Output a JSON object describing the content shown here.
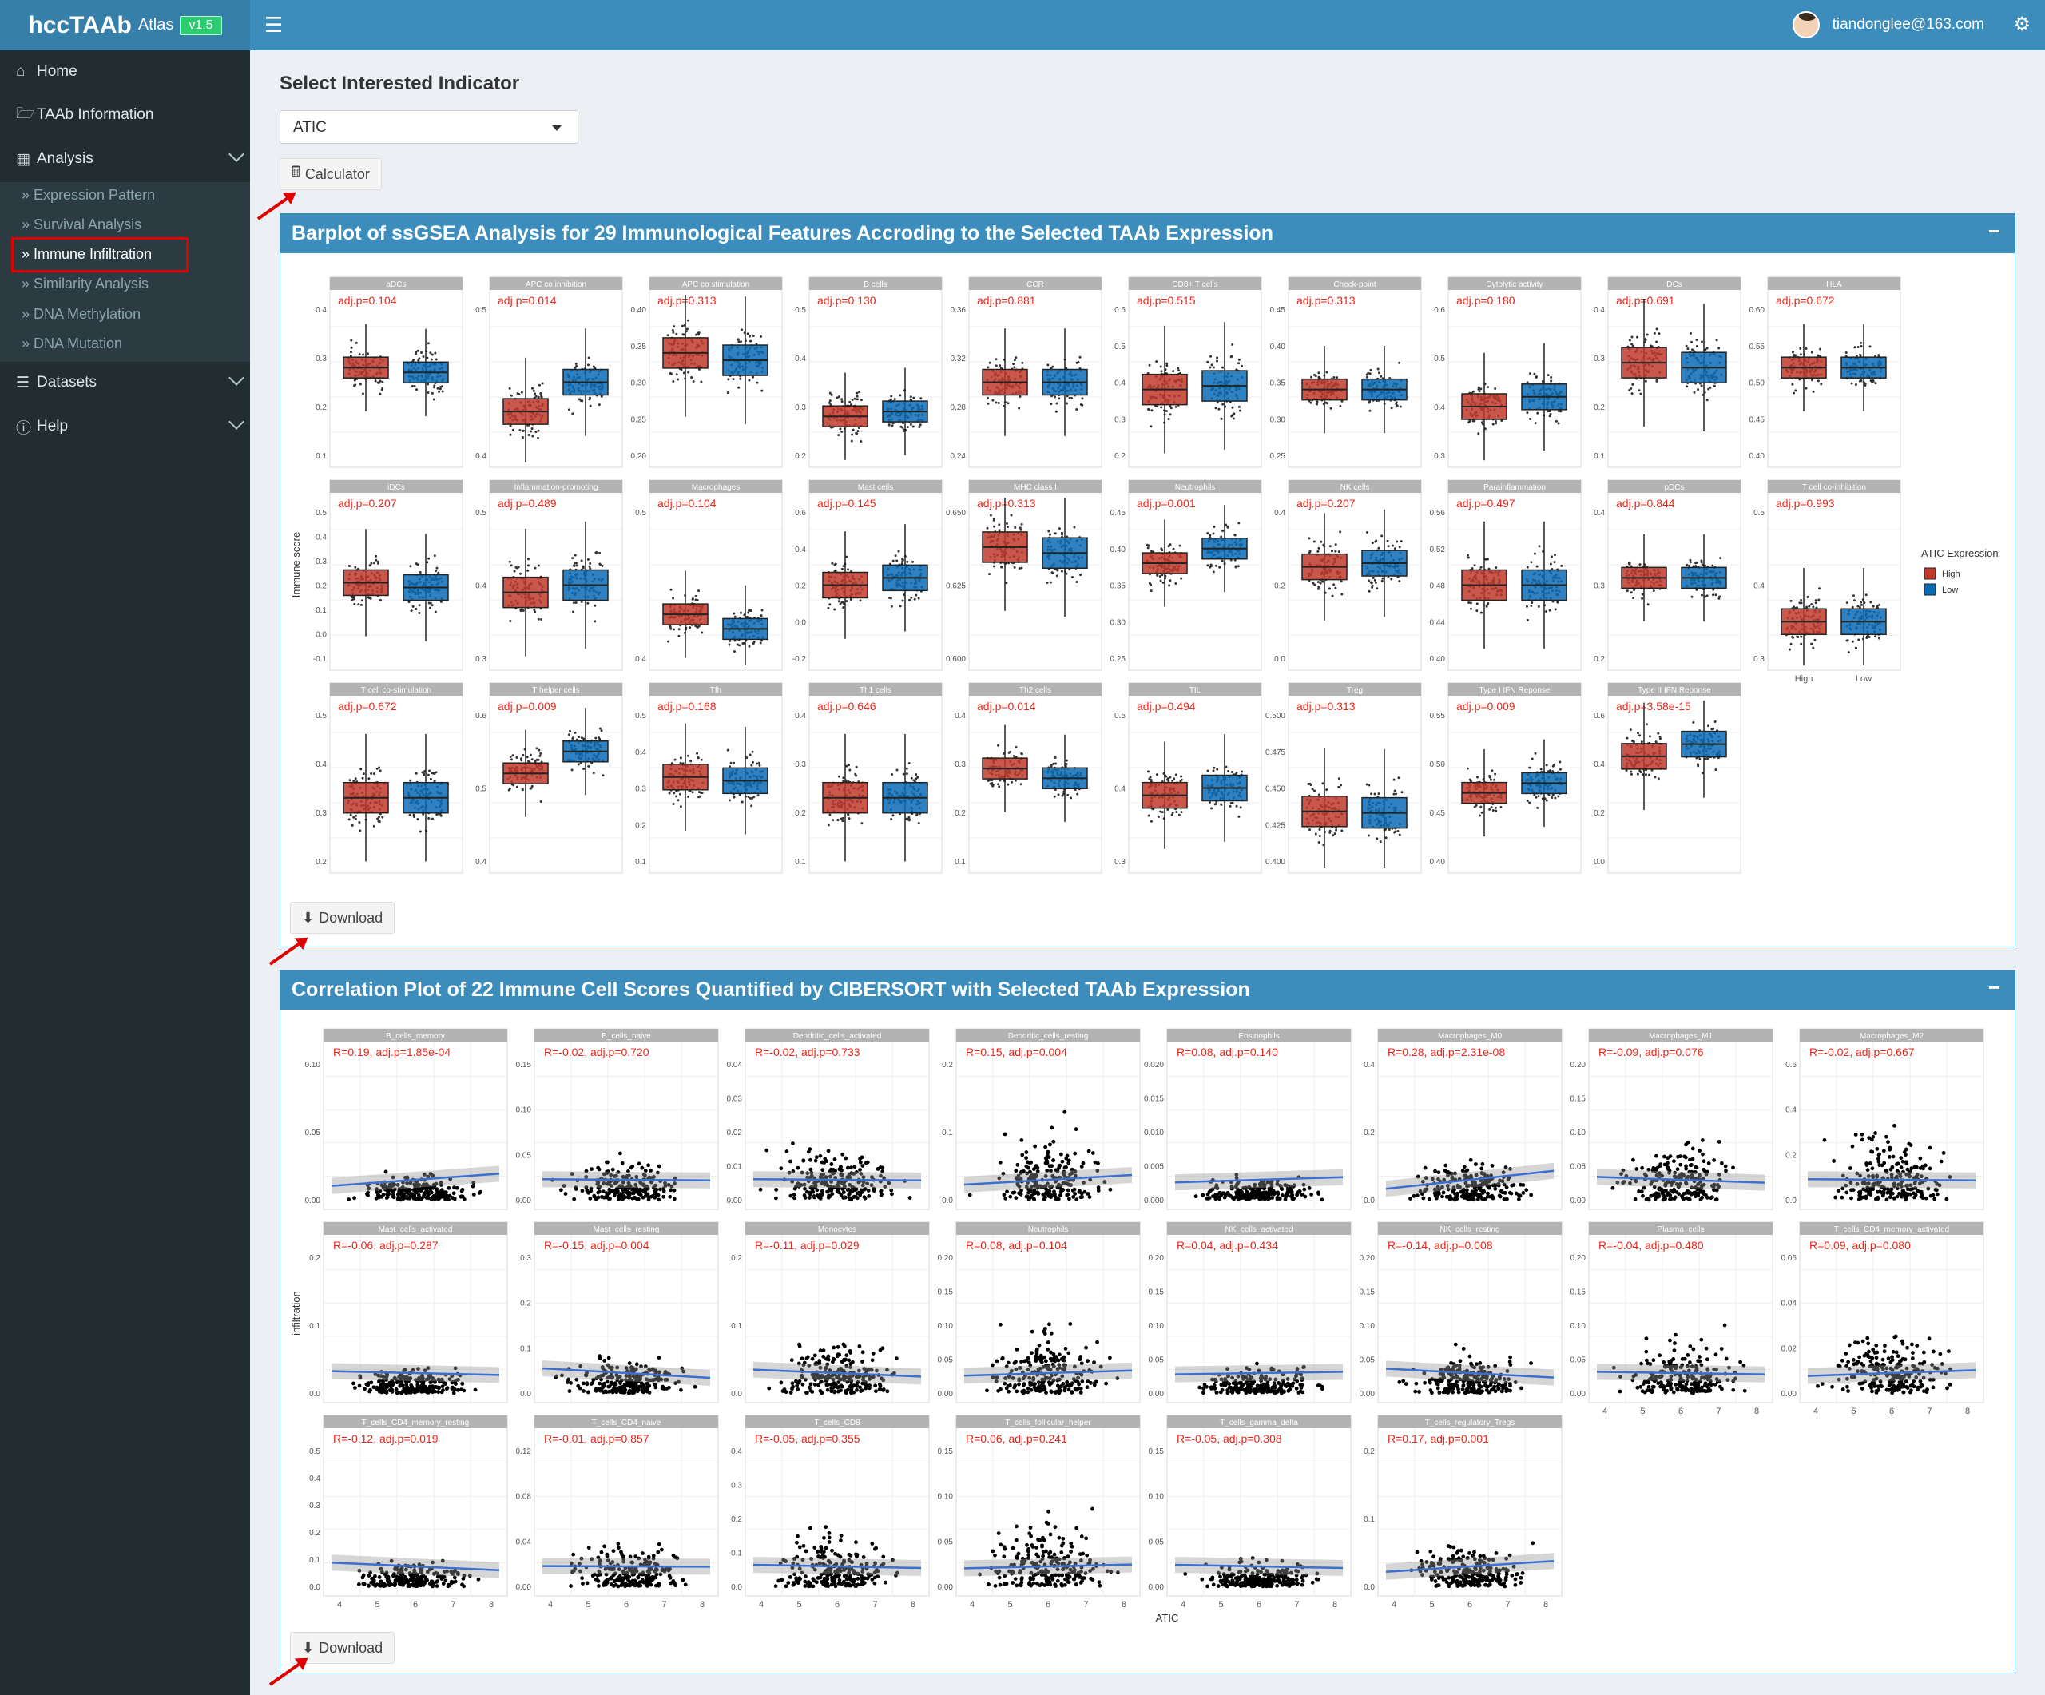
{
  "app": {
    "logo_main": "hccTAAb",
    "logo_sub": "Atlas",
    "version": "v1.5",
    "user_email": "tiandonglee@163.com"
  },
  "sidebar": {
    "items": [
      {
        "label": "Home",
        "icon": "home-icon"
      },
      {
        "label": "TAAb Information",
        "icon": "folder-open-icon"
      },
      {
        "label": "Analysis",
        "icon": "bar-chart-icon"
      },
      {
        "label": "Datasets",
        "icon": "database-icon"
      },
      {
        "label": "Help",
        "icon": "info-icon"
      }
    ],
    "sub_items": [
      "Expression Pattern",
      "Survival Analysis",
      "Immune Infiltration",
      "Similarity Analysis",
      "DNA Methylation",
      "DNA Mutation"
    ],
    "active_sub": "Immune Infiltration"
  },
  "main": {
    "indicator_title": "Select Interested Indicator",
    "indicator_value": "ATIC",
    "calculator_label": "Calculator",
    "box1_title": "Barplot of ssGSEA Analysis for 29 Immunological Features Accroding to the Selected TAAb Expression",
    "box2_title": "Correlation Plot of 22 Immune Cell Scores Quantified by CIBERSORT with Selected TAAb Expression",
    "download_label": "Download",
    "collapse_symbol": "−"
  },
  "colors": {
    "high": "#c0392b",
    "low": "#0b6bb5",
    "panel_strip": "#b3b3b3",
    "panel_text": "#e8271b",
    "fit_line": "#3b6fd1"
  },
  "chart_data": [
    {
      "type": "boxplot",
      "ylabel": "Immune score",
      "legend": {
        "title": "ATIC Expression",
        "entries": [
          "High",
          "Low"
        ],
        "position": "right"
      },
      "x_categories": [
        "High",
        "Low"
      ],
      "panels": [
        {
          "name": "aDCs",
          "p": "adj.p=0.104",
          "ticks": [
            "0.4",
            "0.3",
            "0.2",
            "0.1"
          ],
          "high": 0.28,
          "low": 0.27
        },
        {
          "name": "APC co inhibition",
          "p": "adj.p=0.014",
          "ticks": [
            "0.5",
            "0.4"
          ],
          "high": 0.43,
          "low": 0.45
        },
        {
          "name": "APC co stimulation",
          "p": "adj.p=0.313",
          "ticks": [
            "0.40",
            "0.35",
            "0.30",
            "0.25",
            "0.20"
          ],
          "high": 0.34,
          "low": 0.33
        },
        {
          "name": "B cells",
          "p": "adj.p=0.130",
          "ticks": [
            "0.5",
            "0.4",
            "0.3",
            "0.2"
          ],
          "high": 0.28,
          "low": 0.29
        },
        {
          "name": "CCR",
          "p": "adj.p=0.881",
          "ticks": [
            "0.36",
            "0.32",
            "0.28",
            "0.24"
          ],
          "high": 0.3,
          "low": 0.3
        },
        {
          "name": "CD8+ T cells",
          "p": "adj.p=0.515",
          "ticks": [
            "0.6",
            "0.5",
            "0.4",
            "0.3",
            "0.2"
          ],
          "high": 0.38,
          "low": 0.39
        },
        {
          "name": "Check-point",
          "p": "adj.p=0.313",
          "ticks": [
            "0.45",
            "0.40",
            "0.35",
            "0.30",
            "0.25"
          ],
          "high": 0.34,
          "low": 0.34
        },
        {
          "name": "Cytolytic activity",
          "p": "adj.p=0.180",
          "ticks": [
            "0.6",
            "0.5",
            "0.4",
            "0.3"
          ],
          "high": 0.4,
          "low": 0.42
        },
        {
          "name": "DCs",
          "p": "adj.p=0.691",
          "ticks": [
            "0.4",
            "0.3",
            "0.2",
            "0.1"
          ],
          "high": 0.29,
          "low": 0.28
        },
        {
          "name": "HLA",
          "p": "adj.p=0.672",
          "ticks": [
            "0.60",
            "0.55",
            "0.50",
            "0.45",
            "0.40"
          ],
          "high": 0.52,
          "low": 0.52
        },
        {
          "name": "iDCs",
          "p": "adj.p=0.207",
          "ticks": [
            "0.5",
            "0.4",
            "0.3",
            "0.2",
            "0.1",
            "0.0",
            "-0.1"
          ],
          "high": 0.21,
          "low": 0.19
        },
        {
          "name": "Inflammation-promoting",
          "p": "adj.p=0.489",
          "ticks": [
            "0.5",
            "0.4",
            "0.3"
          ],
          "high": 0.39,
          "low": 0.4
        },
        {
          "name": "Macrophages",
          "p": "adj.p=0.104",
          "ticks": [
            "0.5",
            "0.4"
          ],
          "high": 0.43,
          "low": 0.42
        },
        {
          "name": "Mast cells",
          "p": "adj.p=0.145",
          "ticks": [
            "0.6",
            "0.4",
            "0.2",
            "0.0",
            "-0.2"
          ],
          "high": 0.2,
          "low": 0.24
        },
        {
          "name": "MHC class I",
          "p": "adj.p=0.313",
          "ticks": [
            "0.650",
            "0.625",
            "0.600"
          ],
          "high": 0.638,
          "low": 0.636
        },
        {
          "name": "Neutrophils",
          "p": "adj.p=0.001",
          "ticks": [
            "0.45",
            "0.40",
            "0.35",
            "0.30",
            "0.25"
          ],
          "high": 0.38,
          "low": 0.4
        },
        {
          "name": "NK cells",
          "p": "adj.p=0.207",
          "ticks": [
            "0.4",
            "0.2",
            "0.0"
          ],
          "high": 0.25,
          "low": 0.26
        },
        {
          "name": "Parainflammation",
          "p": "adj.p=0.497",
          "ticks": [
            "0.56",
            "0.52",
            "0.48",
            "0.44",
            "0.40"
          ],
          "high": 0.48,
          "low": 0.48
        },
        {
          "name": "pDCs",
          "p": "adj.p=0.844",
          "ticks": [
            "0.4",
            "0.3",
            "0.2"
          ],
          "high": 0.31,
          "low": 0.31
        },
        {
          "name": "T cell co-inhibition",
          "p": "adj.p=0.993",
          "ticks": [
            "0.5",
            "0.4",
            "0.3"
          ],
          "high": 0.35,
          "low": 0.35
        },
        {
          "name": "T cell co-stimulation",
          "p": "adj.p=0.672",
          "ticks": [
            "0.5",
            "0.4",
            "0.3",
            "0.2"
          ],
          "high": 0.33,
          "low": 0.33
        },
        {
          "name": "T helper cells",
          "p": "adj.p=0.009",
          "ticks": [
            "0.6",
            "0.5",
            "0.4"
          ],
          "high": 0.52,
          "low": 0.55
        },
        {
          "name": "Tfh",
          "p": "adj.p=0.168",
          "ticks": [
            "0.5",
            "0.4",
            "0.3",
            "0.2",
            "0.1"
          ],
          "high": 0.33,
          "low": 0.32
        },
        {
          "name": "Th1 cells",
          "p": "adj.p=0.646",
          "ticks": [
            "0.4",
            "0.3",
            "0.2",
            "0.1"
          ],
          "high": 0.23,
          "low": 0.23
        },
        {
          "name": "Th2 cells",
          "p": "adj.p=0.014",
          "ticks": [
            "0.4",
            "0.3",
            "0.2",
            "0.1"
          ],
          "high": 0.29,
          "low": 0.27
        },
        {
          "name": "TIL",
          "p": "adj.p=0.494",
          "ticks": [
            "0.5",
            "0.4",
            "0.3"
          ],
          "high": 0.39,
          "low": 0.4
        },
        {
          "name": "Treg",
          "p": "adj.p=0.313",
          "ticks": [
            "0.500",
            "0.475",
            "0.450",
            "0.425",
            "0.400"
          ],
          "high": 0.434,
          "low": 0.433
        },
        {
          "name": "Type I IFN Reponse",
          "p": "adj.p=0.009",
          "ticks": [
            "0.55",
            "0.50",
            "0.45",
            "0.40"
          ],
          "high": 0.47,
          "low": 0.48
        },
        {
          "name": "Type II IFN Reponse",
          "p": "adj.p=3.58e-15",
          "ticks": [
            "0.6",
            "0.4",
            "0.2",
            "0.0"
          ],
          "high": 0.43,
          "low": 0.48
        }
      ]
    },
    {
      "type": "scatter",
      "xlabel": "ATIC",
      "ylabel": "infiltration",
      "x_ticks": [
        "4",
        "5",
        "6",
        "7",
        "8"
      ],
      "panels": [
        {
          "name": "B_cells_memory",
          "label": "R=0.19, adj.p=1.85e-04",
          "ticks": [
            "0.10",
            "0.05",
            "0.00"
          ]
        },
        {
          "name": "B_cells_naive",
          "label": "R=-0.02, adj.p=0.720",
          "ticks": [
            "0.15",
            "0.10",
            "0.05",
            "0.00"
          ]
        },
        {
          "name": "Dendritic_cells_activated",
          "label": "R=-0.02, adj.p=0.733",
          "ticks": [
            "0.04",
            "0.03",
            "0.02",
            "0.01",
            "0.00"
          ]
        },
        {
          "name": "Dendritic_cells_resting",
          "label": "R=0.15, adj.p=0.004",
          "ticks": [
            "0.2",
            "0.1",
            "0.0"
          ]
        },
        {
          "name": "Eosinophils",
          "label": "R=0.08, adj.p=0.140",
          "ticks": [
            "0.020",
            "0.015",
            "0.010",
            "0.005",
            "0.000"
          ]
        },
        {
          "name": "Macrophages_M0",
          "label": "R=0.28, adj.p=2.31e-08",
          "ticks": [
            "0.4",
            "0.2",
            "0.0"
          ]
        },
        {
          "name": "Macrophages_M1",
          "label": "R=-0.09, adj.p=0.076",
          "ticks": [
            "0.20",
            "0.15",
            "0.10",
            "0.05",
            "0.00"
          ]
        },
        {
          "name": "Macrophages_M2",
          "label": "R=-0.02, adj.p=0.667",
          "ticks": [
            "0.6",
            "0.4",
            "0.2",
            "0.0"
          ]
        },
        {
          "name": "Mast_cells_activated",
          "label": "R=-0.06, adj.p=0.287",
          "ticks": [
            "0.2",
            "0.1",
            "0.0"
          ]
        },
        {
          "name": "Mast_cells_resting",
          "label": "R=-0.15, adj.p=0.004",
          "ticks": [
            "0.3",
            "0.2",
            "0.1",
            "0.0"
          ]
        },
        {
          "name": "Monocytes",
          "label": "R=-0.11, adj.p=0.029",
          "ticks": [
            "0.2",
            "0.1",
            "0.0"
          ]
        },
        {
          "name": "Neutrophils",
          "label": "R=0.08, adj.p=0.104",
          "ticks": [
            "0.20",
            "0.15",
            "0.10",
            "0.05",
            "0.00"
          ]
        },
        {
          "name": "NK_cells_activated",
          "label": "R=0.04, adj.p=0.434",
          "ticks": [
            "0.20",
            "0.15",
            "0.10",
            "0.05",
            "0.00"
          ]
        },
        {
          "name": "NK_cells_resting",
          "label": "R=-0.14, adj.p=0.008",
          "ticks": [
            "0.20",
            "0.15",
            "0.10",
            "0.05",
            "0.00"
          ]
        },
        {
          "name": "Plasma_cells",
          "label": "R=-0.04, adj.p=0.480",
          "ticks": [
            "0.20",
            "0.15",
            "0.10",
            "0.05",
            "0.00"
          ]
        },
        {
          "name": "T_cells_CD4_memory_activated",
          "label": "R=0.09, adj.p=0.080",
          "ticks": [
            "0.06",
            "0.04",
            "0.02",
            "0.00"
          ]
        },
        {
          "name": "T_cells_CD4_memory_resting",
          "label": "R=-0.12, adj.p=0.019",
          "ticks": [
            "0.5",
            "0.4",
            "0.3",
            "0.2",
            "0.1",
            "0.0"
          ]
        },
        {
          "name": "T_cells_CD4_naive",
          "label": "R=-0.01, adj.p=0.857",
          "ticks": [
            "0.12",
            "0.08",
            "0.04",
            "0.00"
          ]
        },
        {
          "name": "T_cells_CD8",
          "label": "R=-0.05, adj.p=0.355",
          "ticks": [
            "0.4",
            "0.3",
            "0.2",
            "0.1",
            "0.0"
          ]
        },
        {
          "name": "T_cells_follicular_helper",
          "label": "R=0.06, adj.p=0.241",
          "ticks": [
            "0.15",
            "0.10",
            "0.05",
            "0.00"
          ]
        },
        {
          "name": "T_cells_gamma_delta",
          "label": "R=-0.05, adj.p=0.308",
          "ticks": [
            "0.15",
            "0.10",
            "0.05",
            "0.00"
          ]
        },
        {
          "name": "T_cells_regulatory_Tregs",
          "label": "R=0.17, adj.p=0.001",
          "ticks": [
            "0.2",
            "0.1",
            "0.0"
          ]
        }
      ]
    }
  ]
}
